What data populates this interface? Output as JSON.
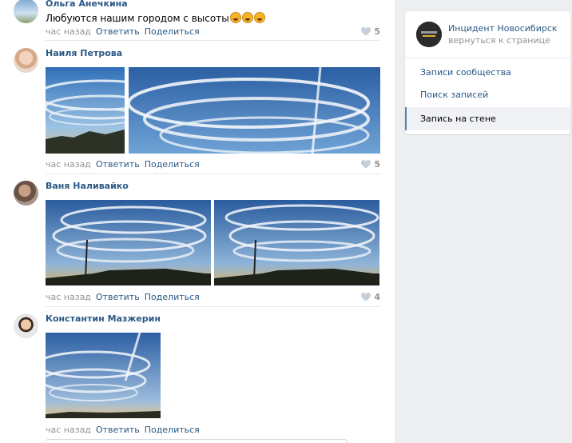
{
  "comments": [
    {
      "author": "Ольга Анечкина",
      "text": "Любуются нашим городом с высоты",
      "time": "час назад",
      "reply": "Ответить",
      "share": "Поделиться",
      "likes": "5"
    },
    {
      "author": "Наиля Петрова",
      "time": "час назад",
      "reply": "Ответить",
      "share": "Поделиться",
      "likes": "5"
    },
    {
      "author": "Ваня Наливайко",
      "time": "час назад",
      "reply": "Ответить",
      "share": "Поделиться",
      "likes": "4"
    },
    {
      "author": "Константин Мазжерин",
      "time": "час назад",
      "reply": "Ответить",
      "share": "Поделиться"
    }
  ],
  "sidebar": {
    "group_name": "Инцидент Новосибирск",
    "back_label": "вернуться к странице",
    "menu": [
      "Записи сообщества",
      "Поиск записей",
      "Запись на стене"
    ],
    "active_index": 2
  },
  "colors": {
    "link": "#2a5885",
    "meta": "#939393",
    "sky": "#3a6fb5"
  }
}
